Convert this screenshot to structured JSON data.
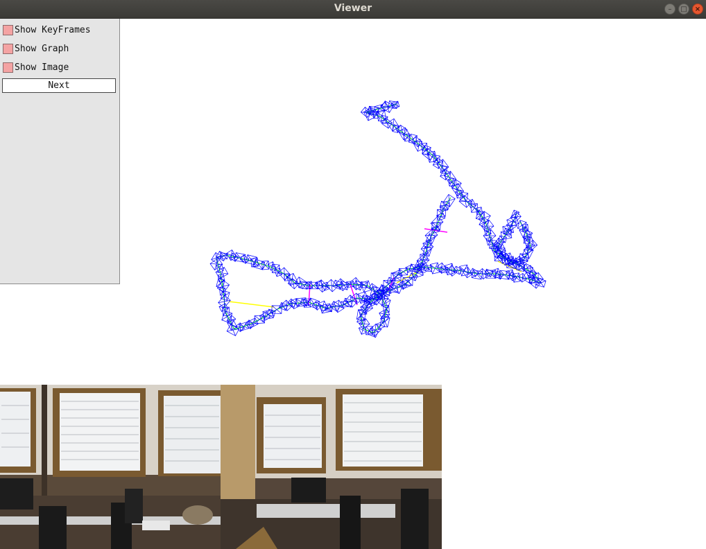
{
  "window": {
    "title": "Viewer"
  },
  "panel": {
    "checkboxes": [
      {
        "label": "Show KeyFrames",
        "checked": false
      },
      {
        "label": "Show Graph",
        "checked": false
      },
      {
        "label": "Show Image",
        "checked": false
      }
    ],
    "next_button": "Next"
  },
  "colors": {
    "checkbox_fill": "#f4a3a3",
    "keyframe": "#0000ff",
    "graph_edge": "#00ff00",
    "loop_edge": "#ffff00",
    "essential_edge": "#ff00ff"
  },
  "icons": {
    "minimize": "minimize-icon",
    "maximize": "maximize-icon",
    "close": "close-icon"
  }
}
